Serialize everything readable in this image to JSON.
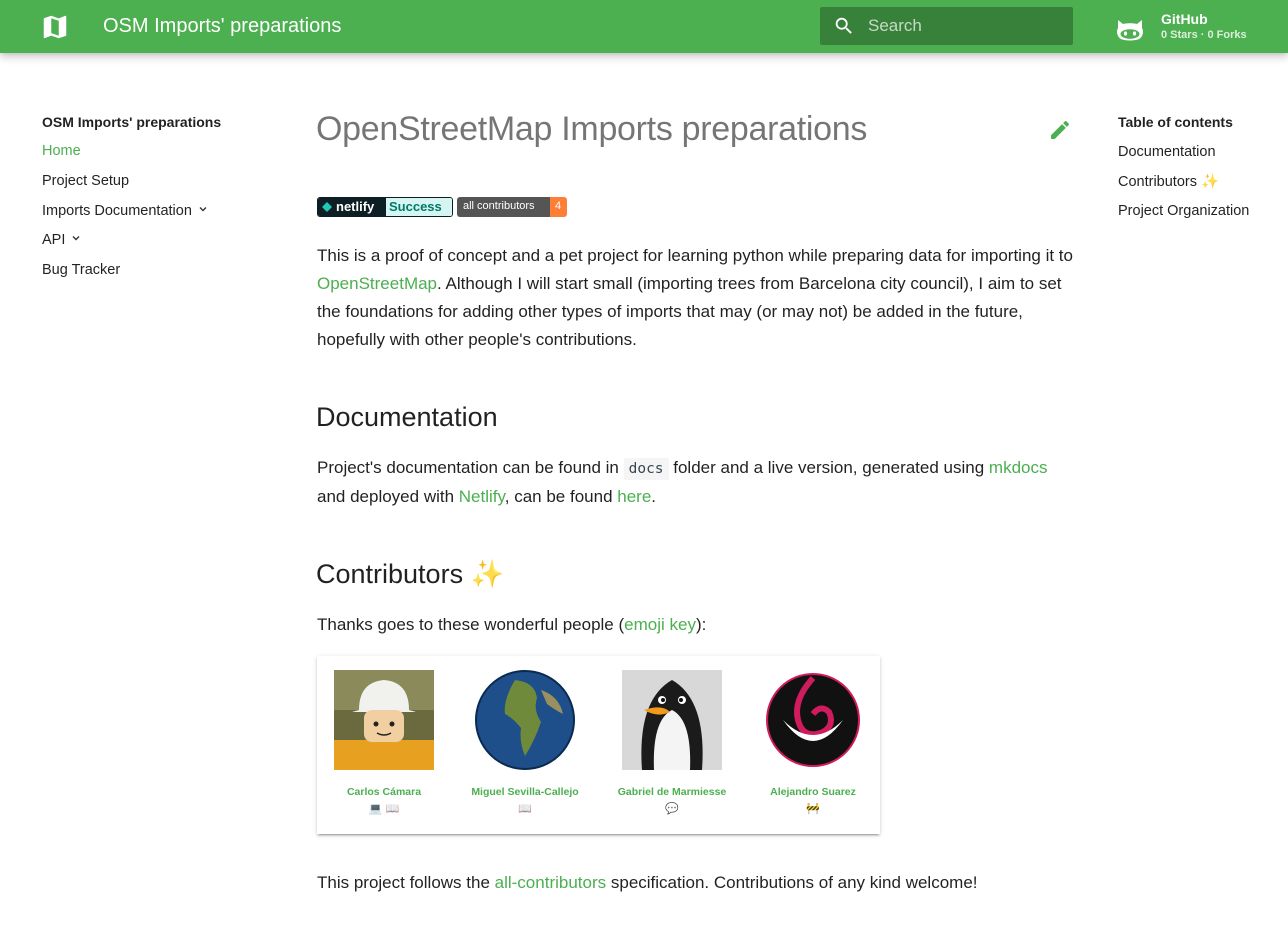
{
  "header": {
    "site_title": "OSM Imports' preparations",
    "search_placeholder": "Search",
    "repo_name": "GitHub",
    "repo_stats": "0 Stars · 0 Forks",
    "brand_color": "#4caf50"
  },
  "nav": {
    "title": "OSM Imports' preparations",
    "items": [
      {
        "label": "Home",
        "active": true
      },
      {
        "label": "Project Setup"
      },
      {
        "label": "Imports Documentation",
        "expandable": true
      },
      {
        "label": "API",
        "expandable": true
      },
      {
        "label": "Bug Tracker"
      }
    ]
  },
  "toc": {
    "title": "Table of contents",
    "items": [
      {
        "label": "Documentation"
      },
      {
        "label": "Contributors ✨"
      },
      {
        "label": "Project Organization"
      }
    ]
  },
  "main": {
    "title": "OpenStreetMap Imports preparations",
    "badges": {
      "netlify_label": "netlify",
      "netlify_status": "Success",
      "contrib_label": "all contributors",
      "contrib_count": "4"
    },
    "intro": {
      "before": "This is a proof of concept and a pet project for learning python while preparing data for importing it to ",
      "link": "OpenStreetMap",
      "after": ". Although I will start small (importing trees from Barcelona city council), I aim to set the foundations for adding other types of imports that may (or may not) be added in the future, hopefully with other people's contributions."
    },
    "documentation": {
      "heading": "Documentation",
      "t1": "Project's documentation can be found in ",
      "code": "docs",
      "t2": " folder and a live version, generated using ",
      "link1": "mkdocs",
      "t3": "and deployed with ",
      "link2": "Netlify",
      "t4": ", can be found ",
      "link3": "here",
      "t5": "."
    },
    "contributors": {
      "heading": "Contributors ✨",
      "thanks_before": "Thanks goes to these wonderful people (",
      "thanks_link": "emoji key",
      "thanks_after": "):",
      "people": [
        {
          "name": "Carlos Cámara",
          "emoji": "💻 📖"
        },
        {
          "name": "Miguel Sevilla-Callejo",
          "emoji": "📖"
        },
        {
          "name": "Gabriel de Marmiesse",
          "emoji": "💬"
        },
        {
          "name": "Alejandro Suarez",
          "emoji": "🚧"
        }
      ],
      "footer_before": "This project follows the ",
      "footer_link": "all-contributors",
      "footer_after": " specification. Contributions of any kind welcome!"
    }
  }
}
